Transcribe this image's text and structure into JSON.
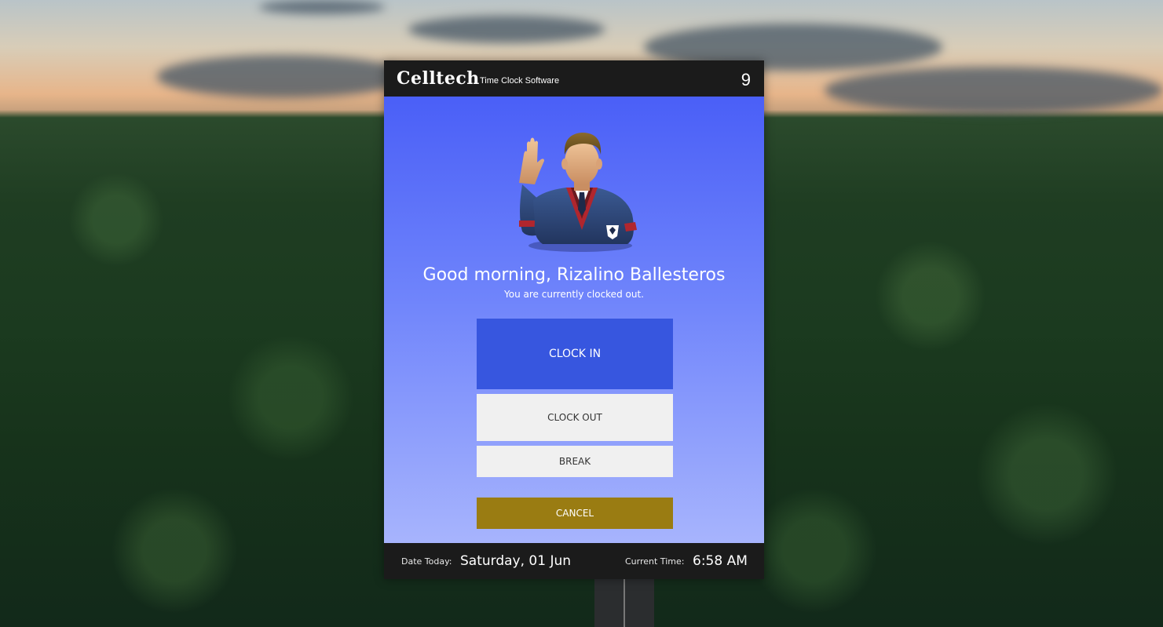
{
  "header": {
    "brand": "Celltech",
    "subtitle": "Time Clock Software",
    "number": "9"
  },
  "main": {
    "avatar_icon": "waving-employee-avatar",
    "greeting": "Good morning, Rizalino Ballesteros",
    "status": "You are currently clocked out."
  },
  "actions": {
    "clock_in": "CLOCK IN",
    "clock_out": "CLOCK OUT",
    "break": "BREAK",
    "cancel": "CANCEL"
  },
  "footer": {
    "date_label": "Date Today:",
    "date_value": "Saturday, 01 Jun",
    "time_label": "Current Time:",
    "time_value": "6:58 AM"
  },
  "colors": {
    "header_bg": "#1b1b1b",
    "clock_in": "#3756df",
    "cancel": "#9a7c12",
    "neutral_button": "#f0f0f0"
  }
}
